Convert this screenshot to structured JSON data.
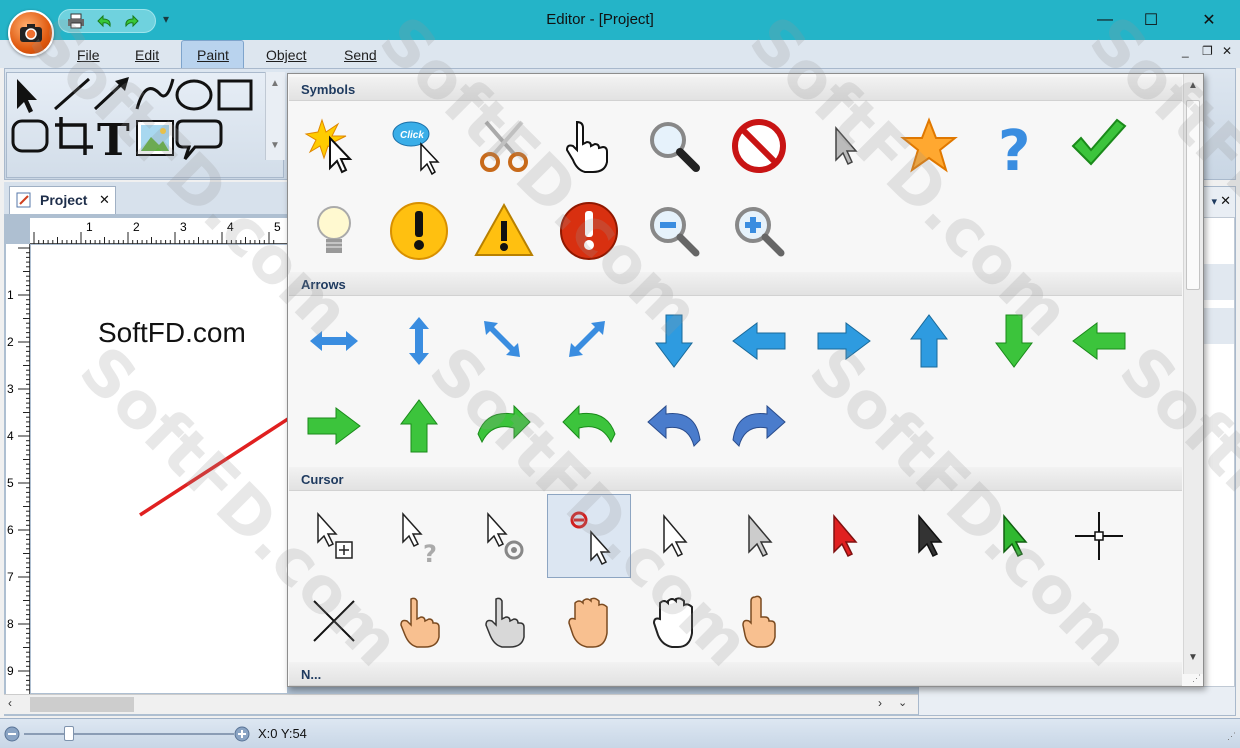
{
  "window": {
    "title": "Editor - [Project]",
    "minimize": "—",
    "maximize": "☐",
    "close": "✕"
  },
  "menu": {
    "file": "File",
    "edit": "Edit",
    "paint": "Paint",
    "object": "Object",
    "send": "Send"
  },
  "mdi": {
    "minimize": "_",
    "restore": "❐",
    "close": "✕"
  },
  "document": {
    "tab_label": "Project",
    "tab_close": "✕",
    "text": "SoftFD.com",
    "ruler_numbers": [
      "1",
      "2",
      "3",
      "4",
      "5"
    ],
    "vruler_numbers": [
      "1",
      "2",
      "3",
      "4",
      "5",
      "6",
      "7",
      "8",
      "9"
    ]
  },
  "status": {
    "coords": "X:0 Y:54"
  },
  "popup": {
    "sections": [
      {
        "title": "Symbols",
        "icons": [
          "starburst-cursor",
          "click-bubble",
          "scissors",
          "hand-pointer",
          "magnifier",
          "no-sign",
          "arrow-cursor",
          "star",
          "question-mark",
          "checkmark",
          "lightbulb",
          "exclamation-yellow",
          "warning-triangle",
          "exclamation-red",
          "zoom-out",
          "zoom-in"
        ]
      },
      {
        "title": "Arrows",
        "icons": [
          "arrow-horizontal",
          "arrow-vertical",
          "arrow-diagonal-se",
          "arrow-diagonal-ne",
          "arrow-down-blue",
          "arrow-left-blue",
          "arrow-right-blue",
          "arrow-up-blue",
          "arrow-down-green",
          "arrow-left-green",
          "arrow-right-green",
          "arrow-up-green",
          "curve-right-green",
          "curve-left-green",
          "curve-left-blue",
          "curve-right-blue"
        ]
      },
      {
        "title": "Cursor",
        "icons": [
          "cursor-copy",
          "cursor-help",
          "cursor-busy",
          "cursor-unavailable",
          "cursor-white",
          "cursor-gray",
          "cursor-red",
          "cursor-dark",
          "cursor-green",
          "crosshair",
          "cursor-x",
          "hand-peach",
          "hand-gray",
          "hand-peach-2",
          "hand-outline",
          "hand-point-up"
        ]
      },
      {
        "title": "N..."
      }
    ],
    "selected": "cursor-unavailable"
  },
  "watermark": "SoftFD.com",
  "colors": {
    "titlebar": "#24b4c8",
    "accent": "#3a8de0",
    "green": "#3cc43c",
    "red": "#e02020"
  }
}
